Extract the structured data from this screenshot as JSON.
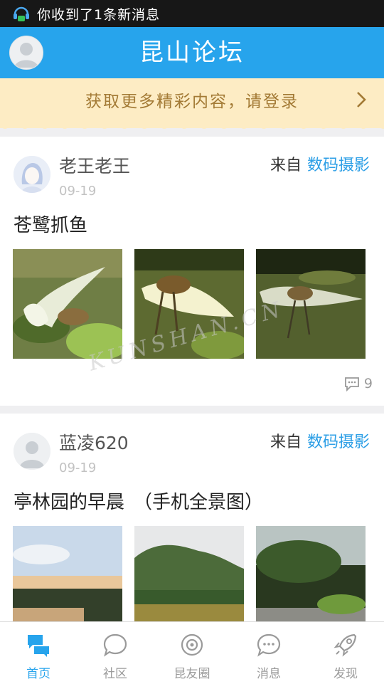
{
  "status_bar": {
    "notification": "你收到了1条新消息"
  },
  "header": {
    "title": "昆山论坛"
  },
  "banner": {
    "text": "获取更多精彩内容，请登录"
  },
  "posts": [
    {
      "author": "老王老王",
      "date": "09-19",
      "from_label": "来自",
      "board": "数码摄影",
      "title": "苍鹭抓鱼",
      "comment_count": "9"
    },
    {
      "author": "蓝凌620",
      "date": "09-19",
      "from_label": "来自",
      "board": "数码摄影",
      "title": "亭林园的早晨　（手机全景图）"
    }
  ],
  "watermark": "KUNSHAN.CN",
  "bottom_nav": [
    {
      "label": "首页",
      "icon": "home-chat-icon",
      "active": true
    },
    {
      "label": "社区",
      "icon": "community-bubble-icon"
    },
    {
      "label": "昆友圈",
      "icon": "friends-circle-icon"
    },
    {
      "label": "消息",
      "icon": "message-icon"
    },
    {
      "label": "发现",
      "icon": "rocket-icon"
    }
  ],
  "colors": {
    "brand_blue": "#27a4ec",
    "banner_bg": "#fdecc4",
    "banner_text": "#a37a35",
    "board_link": "#2d9fe6"
  }
}
